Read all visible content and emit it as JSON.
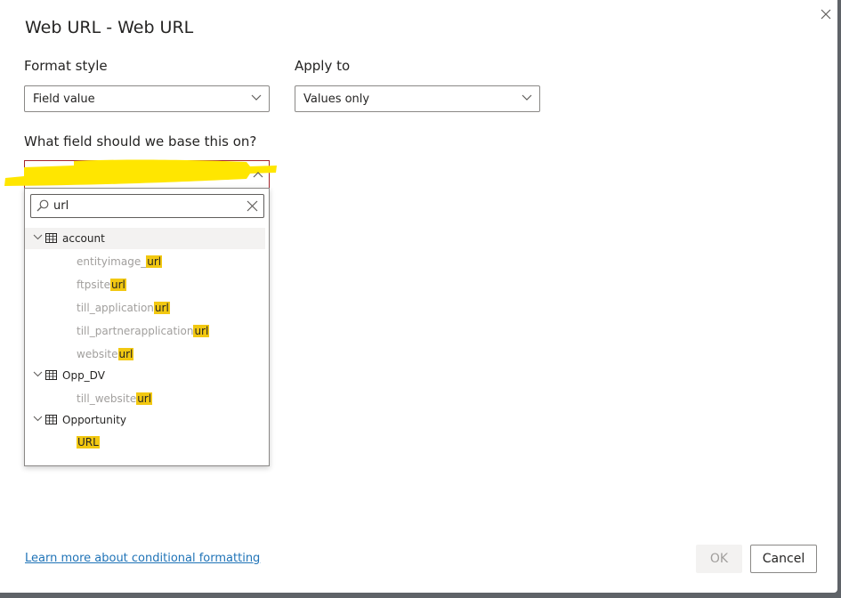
{
  "dialog": {
    "title": "Web URL - Web URL",
    "close_icon": "close-icon"
  },
  "format_style": {
    "label": "Format style",
    "value": "Field value"
  },
  "apply_to": {
    "label": "Apply to",
    "value": "Values only"
  },
  "field": {
    "label": "What field should we base this on?",
    "value": ""
  },
  "search": {
    "value": "url",
    "icon": "search-icon"
  },
  "tree": [
    {
      "name": "account",
      "items": [
        {
          "prefix": "entityimage_",
          "match": "url"
        },
        {
          "prefix": "ftpsite",
          "match": "url"
        },
        {
          "prefix": "till_application",
          "match": "url"
        },
        {
          "prefix": "till_partnerapplication",
          "match": "url"
        },
        {
          "prefix": "website",
          "match": "url"
        }
      ]
    },
    {
      "name": "Opp_DV",
      "items": [
        {
          "prefix": "till_website",
          "match": "url"
        }
      ]
    },
    {
      "name": "Opportunity",
      "items": [
        {
          "prefix": "",
          "match": "URL"
        }
      ]
    }
  ],
  "footer": {
    "learn_more": "Learn more about conditional formatting",
    "ok_label": "OK",
    "cancel_label": "Cancel"
  },
  "colors": {
    "match_highlight": "#f2c811",
    "link": "#1f73b7",
    "error_border": "#a4262c",
    "annotation_marker": "#ffe600"
  }
}
